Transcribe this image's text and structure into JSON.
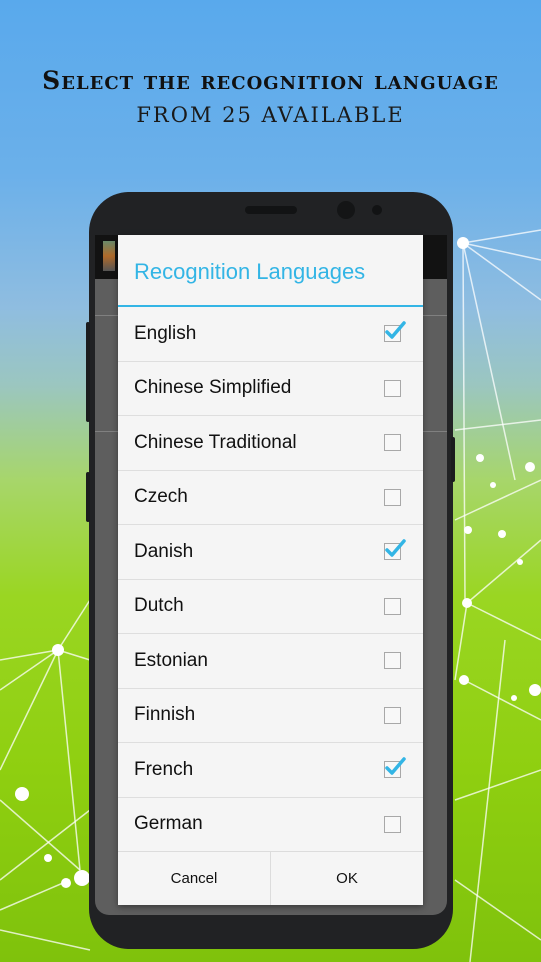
{
  "promo": {
    "headline": "Select the recognition language",
    "subline": "from 25 available"
  },
  "dialog": {
    "title": "Recognition Languages",
    "accent_color": "#33b5e5",
    "languages": [
      {
        "label": "English",
        "checked": true
      },
      {
        "label": "Chinese Simplified",
        "checked": false
      },
      {
        "label": "Chinese Traditional",
        "checked": false
      },
      {
        "label": "Czech",
        "checked": false
      },
      {
        "label": "Danish",
        "checked": true
      },
      {
        "label": "Dutch",
        "checked": false
      },
      {
        "label": "Estonian",
        "checked": false
      },
      {
        "label": "Finnish",
        "checked": false
      },
      {
        "label": "French",
        "checked": true
      },
      {
        "label": "German",
        "checked": false
      }
    ],
    "cancel_label": "Cancel",
    "ok_label": "OK"
  }
}
